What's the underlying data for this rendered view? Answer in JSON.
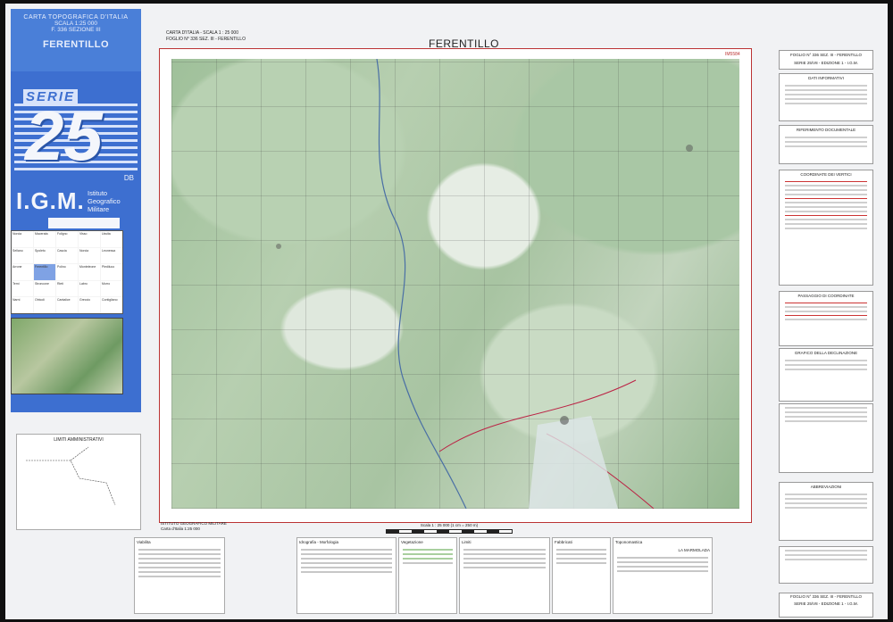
{
  "cover": {
    "title_line1": "CARTA TOPOGRAFICA D'ITALIA",
    "title_line2": "SCALA 1:25 000",
    "title_line3": "F. 336 SEZIONE III",
    "sheet_name": "FERENTILLO",
    "serie_label": "SERIE",
    "serie_number": "25",
    "edition_code": "DB",
    "publisher_abbr": "I.G.M.",
    "publisher_line1": "Istituto",
    "publisher_line2": "Geografico",
    "publisher_line3": "Militare",
    "index_cells": [
      "Norcia",
      "Macerata",
      "Foligno",
      "Visso",
      "Ussita",
      "Sellano",
      "Spoleto",
      "Cascia",
      "Norcia",
      "Leonessa",
      "Arrone",
      "Ferentillo",
      "Polino",
      "Monteleone",
      "Piediluco",
      "Terni",
      "Stroncone",
      "Rieti",
      "Labro",
      "Morro",
      "Narni",
      "Otricoli",
      "Cantalice",
      "Greccio",
      "Contigliano"
    ]
  },
  "header": {
    "left_line1": "CARTA D'ITALIA  -  SCALA 1 : 25 000",
    "left_line2": "FOGLIO N° 336 SEZ. III - FERENTILLO",
    "map_title": "FERENTILLO",
    "code": "IM5584"
  },
  "side_panels": [
    {
      "title": "FOGLIO N° 336 SEZ. III - FERENTILLO",
      "subtitle": "SERIE 25/V8 - EDIZIONE 1 - I.G.M."
    },
    {
      "title": "DATI INFORMATIVI"
    },
    {
      "title": "RIFERIMENTO DOCUMENTALE"
    },
    {
      "title": "COORDINATE DEI VERTICI"
    },
    {
      "title": "PASSAGGIO DI COORDINATE"
    },
    {
      "title": "GRAFICO DELLA DECLINAZIONE"
    },
    {
      "title": "ABBREVIAZIONI"
    }
  ],
  "scale_bar": {
    "label": "Scala 1 : 25 000 (1 cm = 250 m)"
  },
  "institute": {
    "line1": "ISTITUTO GEOGRAFICO MILITARE",
    "line2": "Carta d'Italia 1:25 000"
  },
  "legend_panels": [
    "Viabilita",
    "Idrografia - Morfologia",
    "Vegetazione",
    "Limiti",
    "Fabbricati",
    "Toponomastica",
    "LA MARMOLADA"
  ],
  "admin_box": {
    "title": "LIMITI AMMINISTRATIVI"
  },
  "bottom_right": {
    "line1": "FOGLIO N° 336 SEZ. III - FERENTILLO",
    "line2": "SERIE 25/V8 - EDIZIONE 1 - I.G.M."
  },
  "colors": {
    "cover_blue": "#3d6fd0",
    "frame_red": "#b33",
    "relief_green": "#9fc09a"
  }
}
